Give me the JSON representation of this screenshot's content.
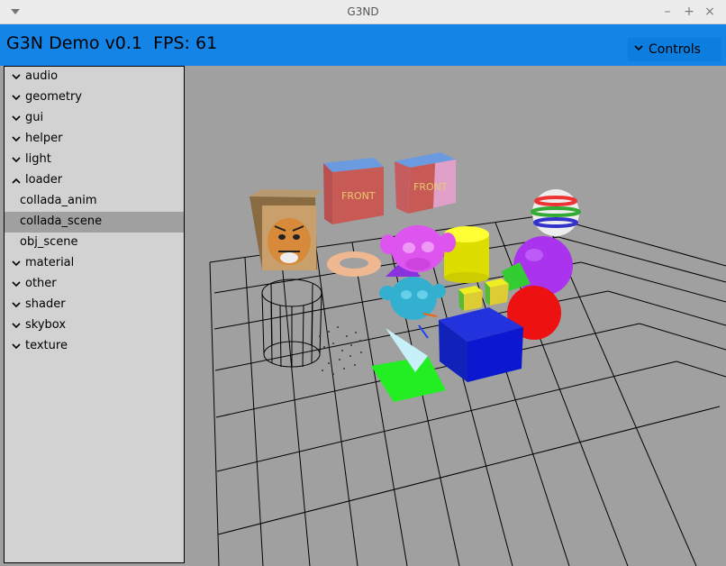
{
  "window": {
    "title": "G3ND"
  },
  "header": {
    "title": "G3N Demo v0.1  FPS: 61"
  },
  "controls": {
    "label": "Controls"
  },
  "sidebar": {
    "items": [
      {
        "label": "audio",
        "type": "category",
        "expanded": false
      },
      {
        "label": "geometry",
        "type": "category",
        "expanded": false
      },
      {
        "label": "gui",
        "type": "category",
        "expanded": false
      },
      {
        "label": "helper",
        "type": "category",
        "expanded": false
      },
      {
        "label": "light",
        "type": "category",
        "expanded": false
      },
      {
        "label": "loader",
        "type": "category",
        "expanded": true
      },
      {
        "label": "collada_anim",
        "type": "entry"
      },
      {
        "label": "collada_scene",
        "type": "entry",
        "selected": true
      },
      {
        "label": "obj_scene",
        "type": "entry"
      },
      {
        "label": "material",
        "type": "category",
        "expanded": false
      },
      {
        "label": "other",
        "type": "category",
        "expanded": false
      },
      {
        "label": "shader",
        "type": "category",
        "expanded": false
      },
      {
        "label": "skybox",
        "type": "category",
        "expanded": false
      },
      {
        "label": "texture",
        "type": "category",
        "expanded": false
      }
    ]
  },
  "scene": {
    "cube_front_text_1": "FRONT",
    "cube_front_text_2": "FRONT"
  },
  "colors": {
    "header": "#1484e6",
    "sidebar": "#d2d2d2",
    "selected": "#a0a0a0",
    "viewport": "#a0a0a0"
  }
}
